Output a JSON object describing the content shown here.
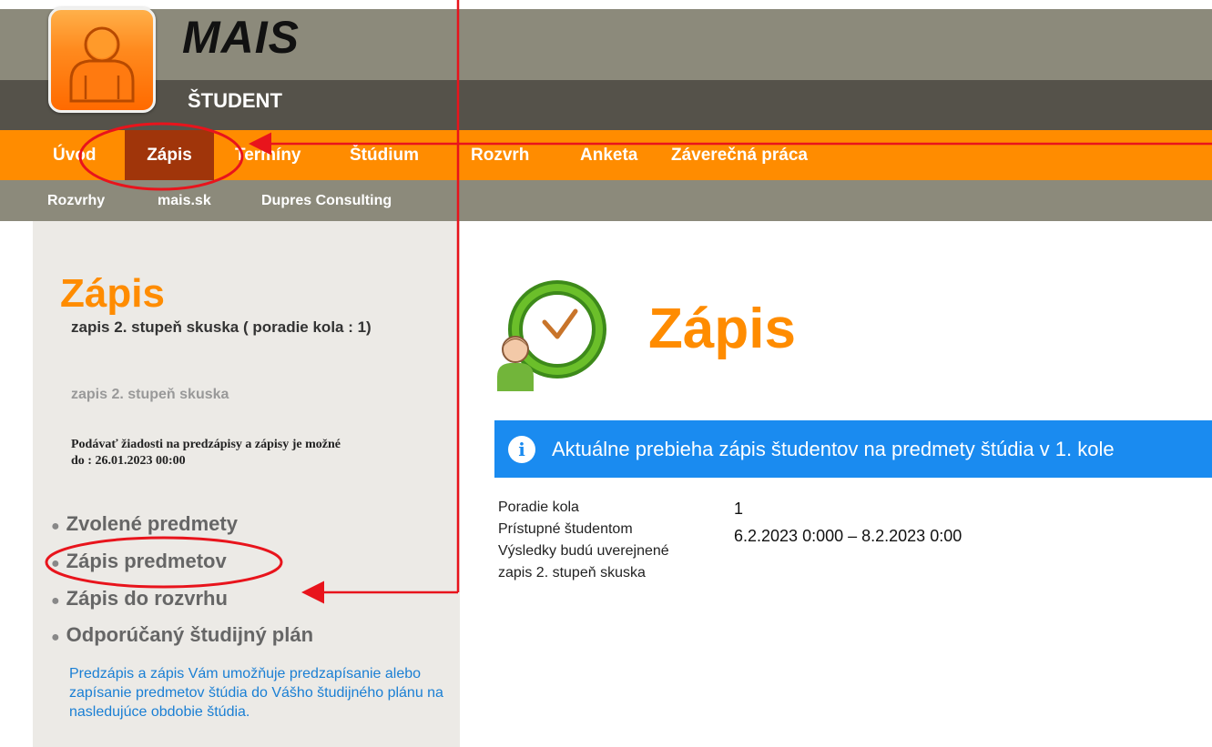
{
  "header": {
    "app_name": "MAIS",
    "app_subtitle": "ŠTUDENT",
    "logo_icon": "student-avatar-icon"
  },
  "menu": {
    "items": [
      {
        "label": "Úvod",
        "active": false
      },
      {
        "label": "Zápis",
        "active": true
      },
      {
        "label": "Termíny",
        "active": false
      },
      {
        "label": "Štúdium",
        "active": false
      },
      {
        "label": "Rozvrh",
        "active": false
      },
      {
        "label": "Anketa",
        "active": false
      },
      {
        "label": "Záverečná práca",
        "active": false
      }
    ]
  },
  "submenu": {
    "items": [
      "Rozvrhy",
      "mais.sk",
      "Dupres Consulting"
    ]
  },
  "sidebar": {
    "title": "Zápis",
    "subtitle": "zapis 2. stupeň skuska ( poradie kola : 1)",
    "subtitle2": "zapis 2. stupeň skuska",
    "note_line1": "Podávať žiadosti na predzápisy a zápisy je možné",
    "note_line2": "do : 26.01.2023 00:00",
    "links": [
      "Zvolené predmety",
      "Zápis predmetov",
      "Zápis do rozvrhu",
      "Odporúčaný študijný plán"
    ],
    "description": "Predzápis a zápis Vám umožňuje predzapísanie alebo zapísanie predmetov štúdia do Vášho študijného plánu na nasledujúce obdobie štúdia."
  },
  "main": {
    "title": "Zápis",
    "alert_text": "Aktuálne prebieha zápis študentov na predmety štúdia v 1. kole",
    "info": {
      "labels": [
        "Poradie kola",
        "Prístupné študentom",
        "Výsledky budú uverejnené",
        "zapis 2. stupeň skuska"
      ],
      "values": [
        "1",
        "6.2.2023 0:000 – 8.2.2023 0:00"
      ]
    }
  },
  "colors": {
    "accent_orange": "#ff8c00",
    "active_menu": "#a0350a",
    "alert_blue": "#1a8bf0",
    "annotation_red": "#e8141c"
  }
}
